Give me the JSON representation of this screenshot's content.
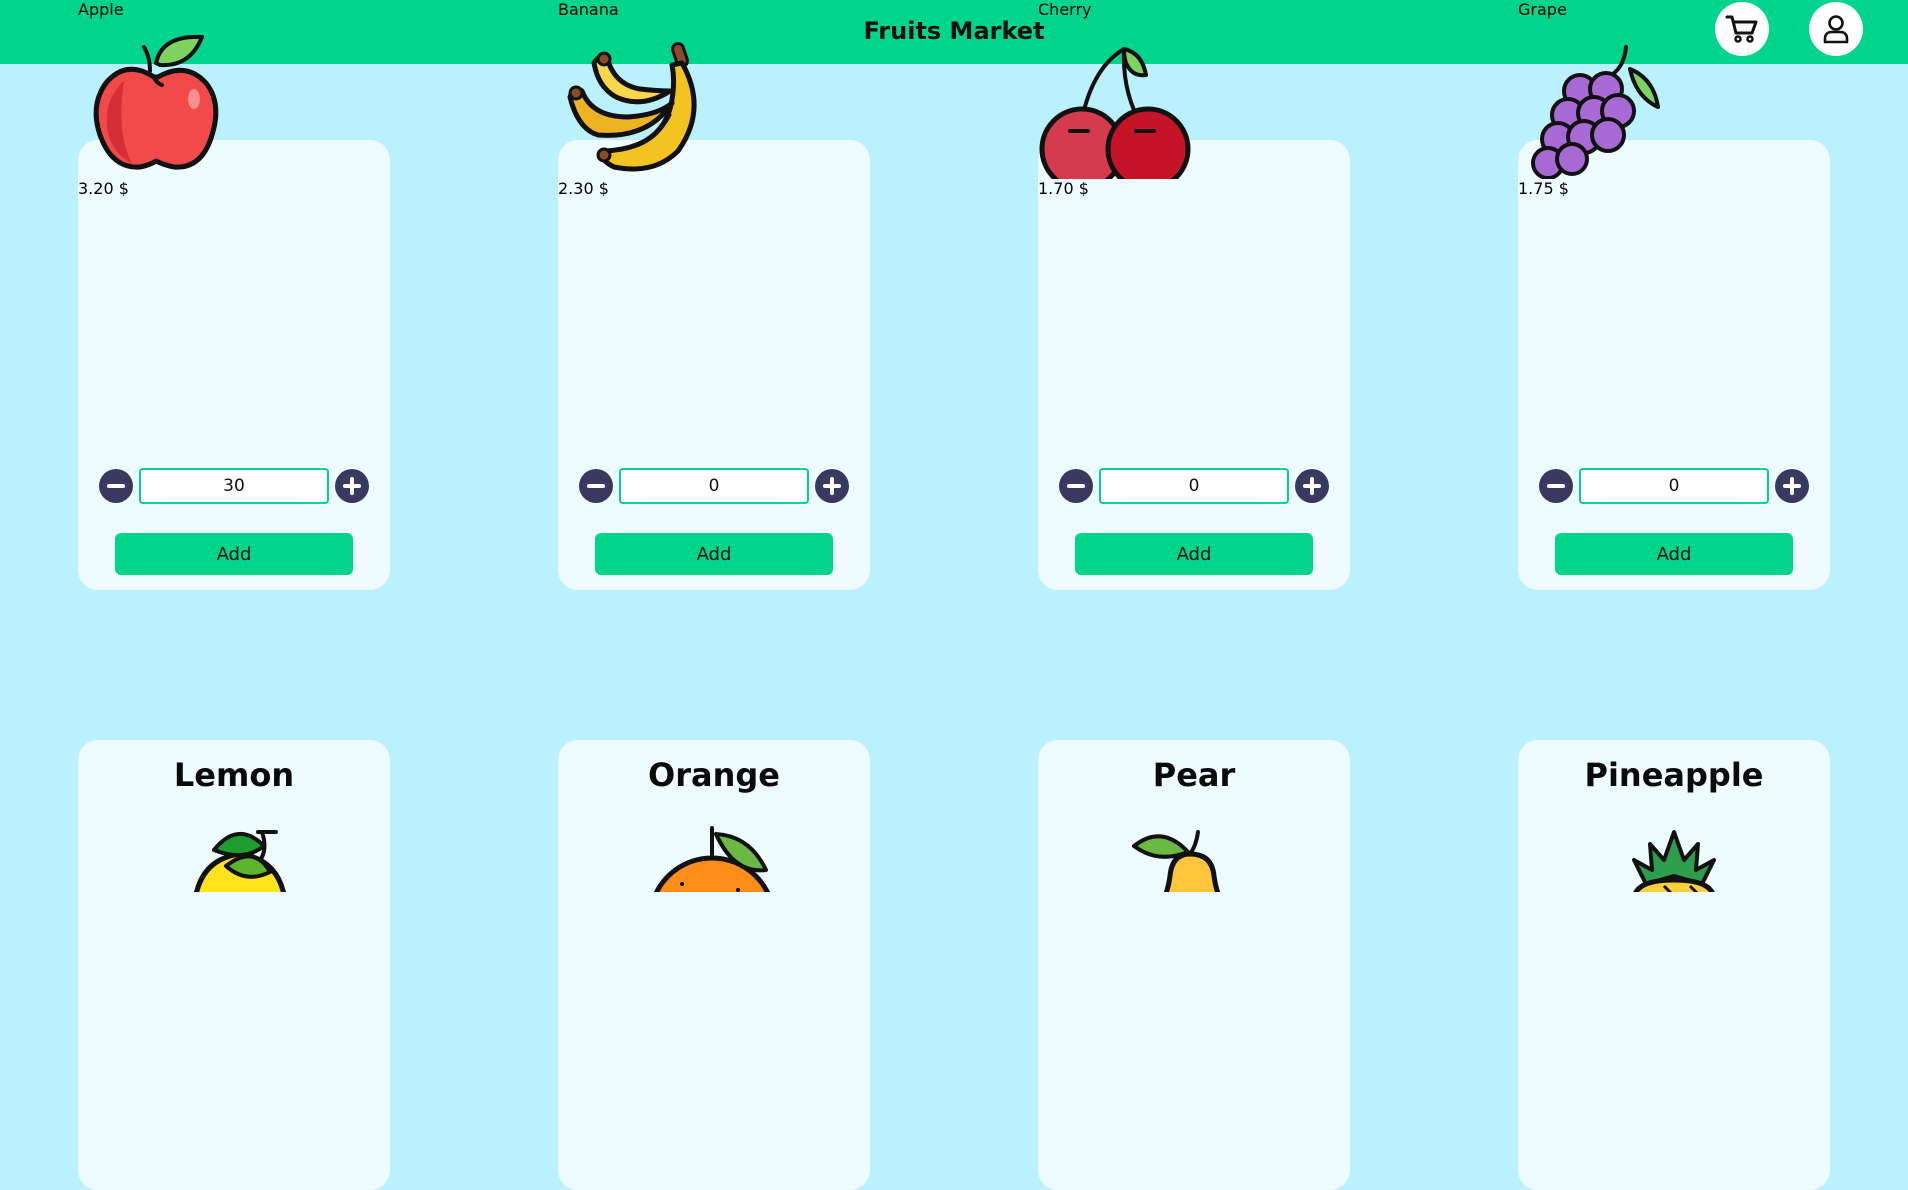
{
  "app": {
    "title": "Fruits Market",
    "cart_icon": "cart-icon",
    "account_icon": "user-icon",
    "brand_color": "#00d48d",
    "background_color": "#bbf0fd"
  },
  "products": [
    {
      "name": "Apple",
      "price": "3.20 $",
      "quantity": "30",
      "add_label": "Add",
      "icon": "apple-icon"
    },
    {
      "name": "Banana",
      "price": "2.30 $",
      "quantity": "0",
      "add_label": "Add",
      "icon": "banana-icon"
    },
    {
      "name": "Cherry",
      "price": "1.70 $",
      "quantity": "0",
      "add_label": "Add",
      "icon": "cherry-icon"
    },
    {
      "name": "Grape",
      "price": "1.75 $",
      "quantity": "0",
      "add_label": "Add",
      "icon": "grape-icon"
    },
    {
      "name": "Lemon",
      "icon": "lemon-icon"
    },
    {
      "name": "Orange",
      "icon": "orange-icon"
    },
    {
      "name": "Pear",
      "icon": "pear-icon"
    },
    {
      "name": "Pineapple",
      "icon": "pineapple-icon"
    }
  ]
}
